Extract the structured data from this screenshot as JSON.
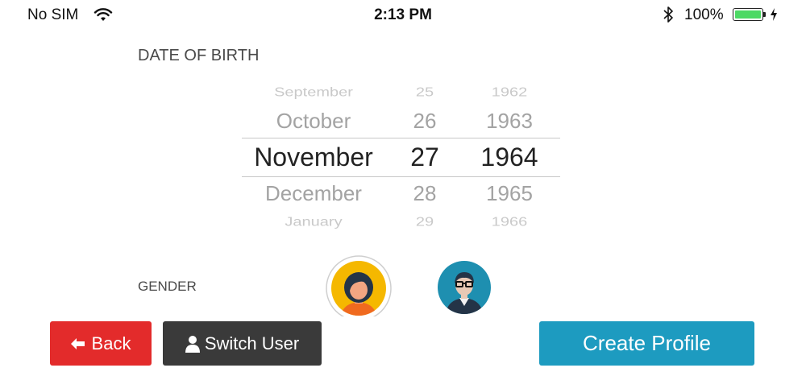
{
  "status_bar": {
    "carrier": "No SIM",
    "time": "2:13 PM",
    "battery_percent": "100%",
    "battery_level": 1.0,
    "battery_color": "#4cd964",
    "icons": [
      "wifi-icon",
      "bluetooth-icon",
      "battery-icon",
      "charging-icon"
    ]
  },
  "form": {
    "dob_label": "DATE OF BIRTH",
    "gender_label": "GENDER"
  },
  "picker": {
    "rows": [
      {
        "month": "September",
        "day": "25",
        "year": "1962"
      },
      {
        "month": "October",
        "day": "26",
        "year": "1963"
      },
      {
        "month": "November",
        "day": "27",
        "year": "1964"
      },
      {
        "month": "December",
        "day": "28",
        "year": "1965"
      },
      {
        "month": "January",
        "day": "29",
        "year": "1966"
      }
    ],
    "selected": {
      "month": "November",
      "day": "27",
      "year": "1964"
    }
  },
  "gender": {
    "options": [
      "female-avatar-icon",
      "male-avatar-icon"
    ],
    "selected": "female"
  },
  "buttons": {
    "back": "Back",
    "switch_user": "Switch User",
    "create_profile": "Create Profile"
  },
  "colors": {
    "back": "#e32b2b",
    "switch_user": "#3a3a3a",
    "create_profile": "#1d9bc0",
    "female_avatar_bg": "#f5b800",
    "male_avatar_bg": "#1e8fb0"
  }
}
